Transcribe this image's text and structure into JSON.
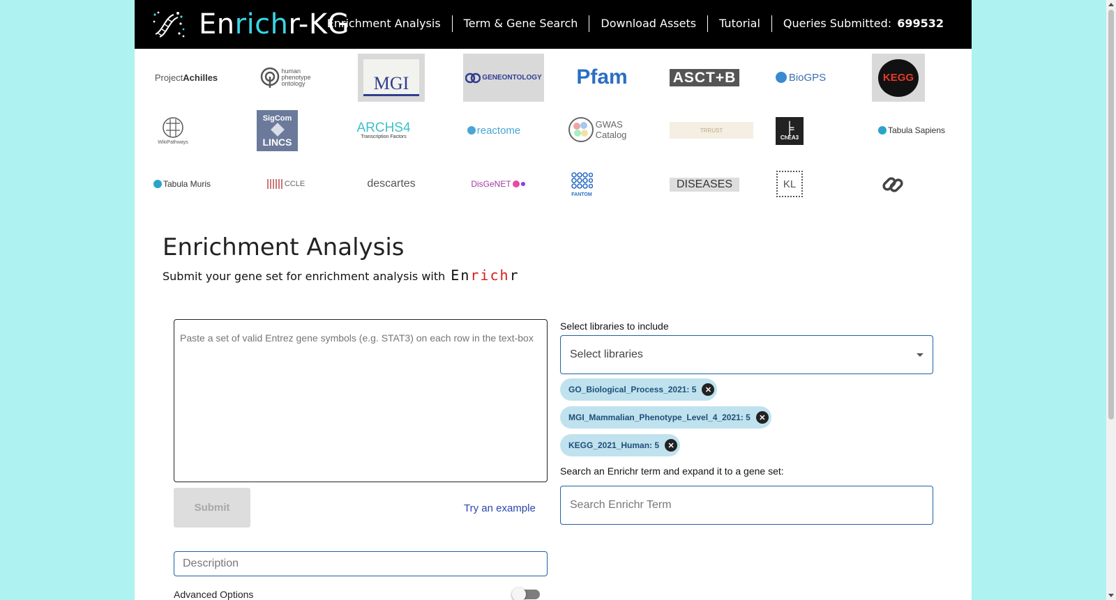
{
  "header": {
    "brand_pre": "En",
    "brand_hl": "rich",
    "brand_post": "r-KG",
    "nav": [
      "Enrichment Analysis",
      "Term & Gene Search",
      "Download Assets",
      "Tutorial"
    ],
    "queries_label": "Queries Submitted:",
    "queries_count": "699532"
  },
  "logos": {
    "achilles_a": "Project ",
    "achilles_b": "Achilles",
    "hpo": [
      "human",
      "phenotype",
      "ontology"
    ],
    "mgi": "MGI",
    "geneontology": "GENEONTOLOGY",
    "pfam": "Pfam",
    "asct": "ASCT+B",
    "biogps": "BioGPS",
    "kegg": "KEGG",
    "wikipathways": "WikiPathways",
    "sigcom_a": "SigCom",
    "sigcom_b": "LINCS",
    "archs4": "ARCHS4",
    "archs4_sub": "Transcription Factors",
    "reactome": "reactome",
    "gwas_a": "GWAS",
    "gwas_b": "Catalog",
    "trrust": "TRRUST",
    "chea3": "ChEA3",
    "tabula_sapiens": "Tabula Sapiens",
    "tabula_muris": "Tabula Muris",
    "ccle": "CCLE",
    "descartes": "descartes",
    "disgenet": "DisGeNET",
    "fantom": "FANTOM",
    "diseases": "DISEASES",
    "kl": "KL"
  },
  "main": {
    "title": "Enrichment Analysis",
    "subtitle": "Submit your gene set for enrichment analysis with",
    "enrichr_a": "En",
    "enrichr_b": "rich",
    "enrichr_c": "r"
  },
  "form": {
    "gene_placeholder": "Paste a set of valid Entrez gene symbols (e.g. STAT3) on each row in the text-box",
    "submit_label": "Submit",
    "example_label": "Try an example",
    "description_placeholder": "Description",
    "advanced_label": "Advanced Options",
    "libraries_label": "Select libraries to include",
    "libraries_placeholder": "Select libraries",
    "chips": [
      "GO_Biological_Process_2021: 5",
      "MGI_Mammalian_Phenotype_Level_4_2021: 5",
      "KEGG_2021_Human: 5"
    ],
    "search_label": "Search an Enrichr term and expand it to a gene set:",
    "search_placeholder": "Search Enrichr Term"
  }
}
